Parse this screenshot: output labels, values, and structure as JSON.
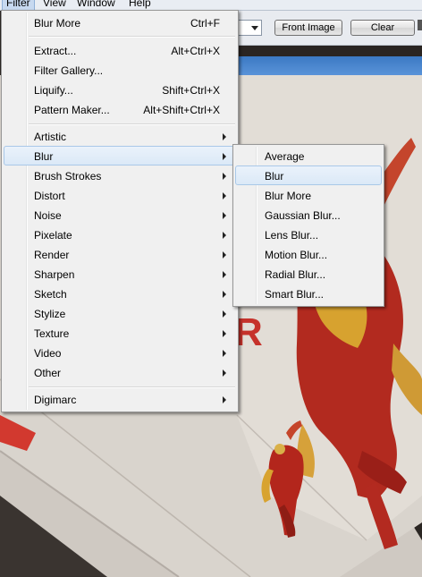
{
  "menubar": {
    "items": [
      {
        "label": "Filter",
        "active": true
      },
      {
        "label": "View",
        "active": false
      },
      {
        "label": "Window",
        "active": false
      },
      {
        "label": "Help",
        "active": false
      }
    ]
  },
  "options_bar": {
    "front_image_label": "Front Image",
    "clear_label": "Clear"
  },
  "filter_menu": {
    "last_filter": {
      "label": "Blur More",
      "shortcut": "Ctrl+F"
    },
    "group1": [
      {
        "label": "Extract...",
        "shortcut": "Alt+Ctrl+X"
      },
      {
        "label": "Filter Gallery...",
        "shortcut": ""
      },
      {
        "label": "Liquify...",
        "shortcut": "Shift+Ctrl+X"
      },
      {
        "label": "Pattern Maker...",
        "shortcut": "Alt+Shift+Ctrl+X"
      }
    ],
    "group2": [
      {
        "label": "Artistic",
        "highlighted": false
      },
      {
        "label": "Blur",
        "highlighted": true
      },
      {
        "label": "Brush Strokes",
        "highlighted": false
      },
      {
        "label": "Distort",
        "highlighted": false
      },
      {
        "label": "Noise",
        "highlighted": false
      },
      {
        "label": "Pixelate",
        "highlighted": false
      },
      {
        "label": "Render",
        "highlighted": false
      },
      {
        "label": "Sharpen",
        "highlighted": false
      },
      {
        "label": "Sketch",
        "highlighted": false
      },
      {
        "label": "Stylize",
        "highlighted": false
      },
      {
        "label": "Texture",
        "highlighted": false
      },
      {
        "label": "Video",
        "highlighted": false
      },
      {
        "label": "Other",
        "highlighted": false
      }
    ],
    "group3": [
      {
        "label": "Digimarc"
      }
    ]
  },
  "blur_submenu": {
    "items": [
      {
        "label": "Average",
        "highlighted": false
      },
      {
        "label": "Blur",
        "highlighted": true
      },
      {
        "label": "Blur More",
        "highlighted": false
      },
      {
        "label": "Gaussian Blur...",
        "highlighted": false
      },
      {
        "label": "Lens Blur...",
        "highlighted": false
      },
      {
        "label": "Motion Blur...",
        "highlighted": false
      },
      {
        "label": "Radial Blur...",
        "highlighted": false
      },
      {
        "label": "Smart Blur...",
        "highlighted": false
      }
    ]
  },
  "colors": {
    "menu_bg": "#f0f0f0",
    "highlight_bg": "#dbe9f7",
    "highlight_border": "#a9c8e8",
    "title_strip": "#3b79c4"
  },
  "icons": [
    "submenu-arrow-icon",
    "dropdown-arrow-icon"
  ]
}
